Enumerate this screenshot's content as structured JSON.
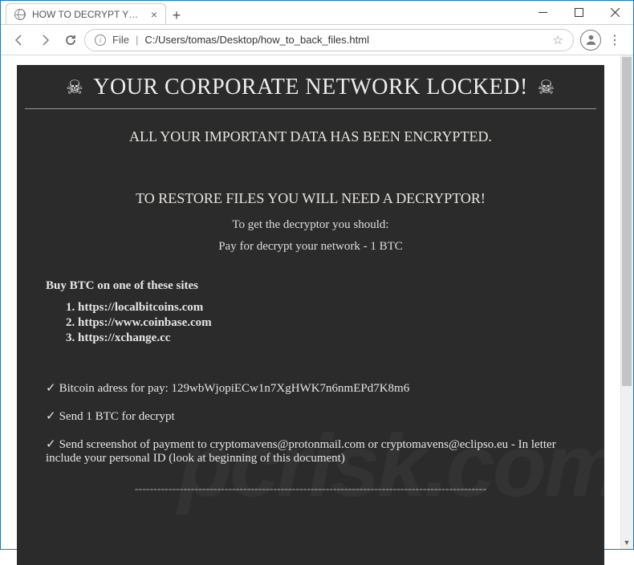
{
  "tab": {
    "title": "HOW TO DECRYPT YOUR FILES"
  },
  "addressbar": {
    "file_label": "File",
    "path": "C:/Users/tomas/Desktop/how_to_back_files.html"
  },
  "ransom": {
    "title": "YOUR CORPORATE NETWORK LOCKED!",
    "subtitle": "ALL YOUR IMPORTANT DATA HAS BEEN ENCRYPTED.",
    "restore_heading": "TO RESTORE FILES YOU WILL NEED A DECRYPTOR!",
    "instruction1": "To get the decryptor you should:",
    "instruction2": "Pay for decrypt your network - 1 BTC",
    "buy_heading": "Buy BTC on one of these sites",
    "sites": [
      "https://localbitcoins.com",
      "https://www.coinbase.com",
      "https://xchange.cc"
    ],
    "step1": "Bitcoin adress for pay: 129wbWjopiECw1n7XgHWK7n6nmEPd7K8m6",
    "step2": "Send 1 BTC for decrypt",
    "step3": "Send screenshot of payment to cryptomavens@protonmail.com or cryptomavens@eclipso.eu - In letter include your personal ID (look at beginning of this document)",
    "dashes": "----------------------------------------------------------------------------------------------"
  },
  "watermark": "pcrisk.com"
}
